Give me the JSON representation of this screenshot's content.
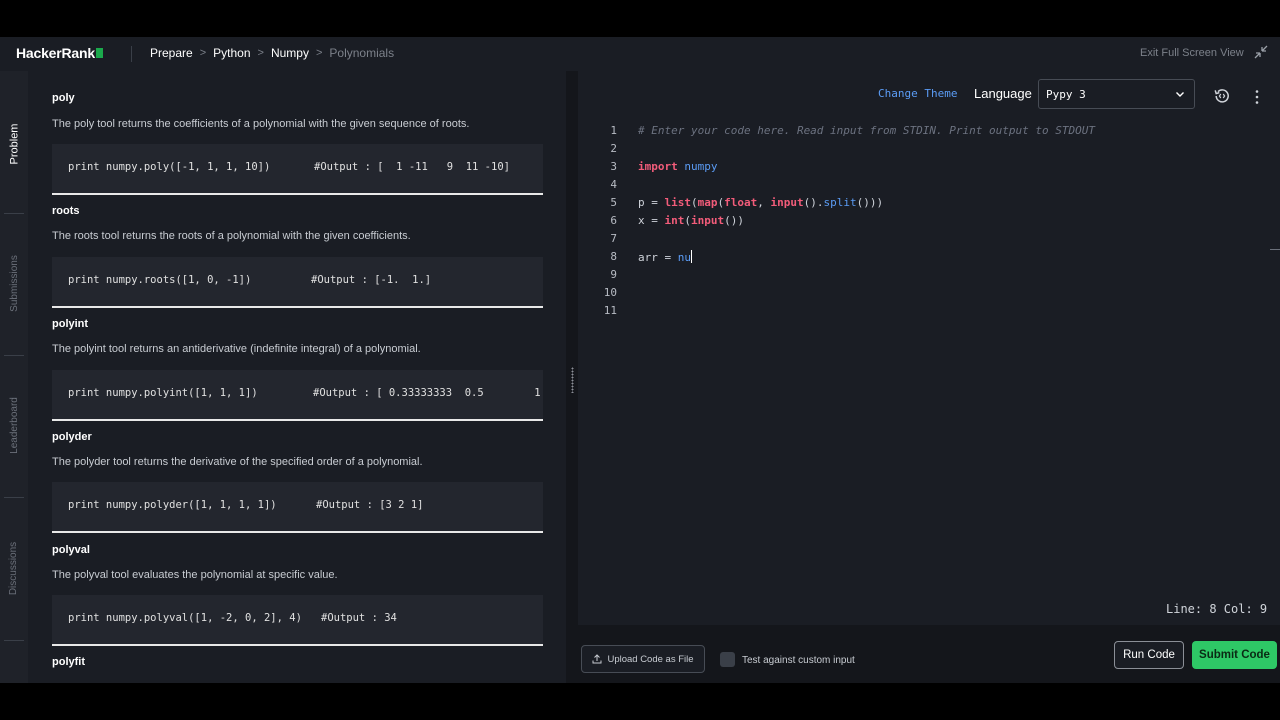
{
  "app": {
    "logo": "HackerRank"
  },
  "breadcrumbs": [
    {
      "label": "Prepare"
    },
    {
      "label": "Python"
    },
    {
      "label": "Numpy"
    },
    {
      "label": "Polynomials"
    }
  ],
  "header": {
    "exit_fullscreen": "Exit Full Screen View"
  },
  "sidebar": {
    "tabs": [
      {
        "label": "Problem",
        "active": true
      },
      {
        "label": "Submissions",
        "active": false
      },
      {
        "label": "Leaderboard",
        "active": false
      },
      {
        "label": "Discussions",
        "active": false
      }
    ]
  },
  "problem": {
    "sections": [
      {
        "title": "poly",
        "desc": "The poly tool returns the coefficients of a polynomial with the given sequence of roots.",
        "code": "print numpy.poly([-1, 1, 1, 10])",
        "output": "#Output : [  1 -11   9  11 -10]"
      },
      {
        "title": "roots",
        "desc": "The roots tool returns the roots of a polynomial with the given coefficients.",
        "code": "print numpy.roots([1, 0, -1])",
        "output": "#Output : [-1.  1.]"
      },
      {
        "title": "polyint",
        "desc": "The polyint tool returns an antiderivative (indefinite integral) of a polynomial.",
        "code": "print numpy.polyint([1, 1, 1])",
        "output": "#Output : [ 0.33333333  0.5        1."
      },
      {
        "title": "polyder",
        "desc": "The polyder tool returns the derivative of the specified order of a polynomial.",
        "code": "print numpy.polyder([1, 1, 1, 1])",
        "output": "#Output : [3 2 1]"
      },
      {
        "title": "polyval",
        "desc": "The polyval tool evaluates the polynomial at specific value.",
        "code": "print numpy.polyval([1, -2, 0, 2], 4)",
        "output": "#Output : 34"
      },
      {
        "title": "polyfit",
        "desc": "",
        "code": "",
        "output": ""
      }
    ]
  },
  "editor": {
    "change_theme": "Change Theme",
    "language_label": "Language",
    "language_value": "Pypy 3",
    "line_numbers": [
      "1",
      "2",
      "3",
      "4",
      "5",
      "6",
      "7",
      "8",
      "9",
      "10",
      "11"
    ],
    "code": {
      "line1": "# Enter your code here. Read input from STDIN. Print output to STDOUT",
      "line3_kw": "import",
      "line3_mod": "numpy",
      "line5_a": "p = ",
      "line5_list": "list",
      "line5_b": "(",
      "line5_map": "map",
      "line5_c": "(",
      "line5_float": "float",
      "line5_d": ", ",
      "line5_input": "input",
      "line5_e": "().",
      "line5_split": "split",
      "line5_f": "()))",
      "line6_a": "x = ",
      "line6_int": "int",
      "line6_b": "(",
      "line6_input": "input",
      "line6_c": "())",
      "line8_a": "arr = ",
      "line8_b": "nu"
    },
    "status": "Line: 8 Col: 9"
  },
  "footer": {
    "upload": "Upload Code as File",
    "custom_input": "Test against custom input",
    "run": "Run Code",
    "submit": "Submit Code"
  }
}
